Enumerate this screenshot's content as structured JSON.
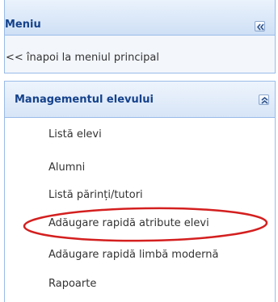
{
  "menu": {
    "title": "Meniu",
    "back_link": "<< înapoi la meniul principal"
  },
  "section": {
    "title": "Managementul elevului",
    "items": [
      {
        "label": "Listă elevi"
      },
      {
        "label": "Alumni"
      },
      {
        "label": "Listă părinți/tutori"
      },
      {
        "label": "Adăugare rapidă atribute elevi"
      },
      {
        "label": "Adăugare rapidă limbă modernă"
      },
      {
        "label": "Rapoarte"
      }
    ]
  },
  "annotation": {
    "highlighted_item": "Adăugare rapidă atribute elevi",
    "color": "#d41f1f"
  },
  "colors": {
    "header_text": "#15428b",
    "border": "#99bbe8"
  },
  "icons": {
    "menu_collapse": "double-chevron-left-icon",
    "section_collapse": "double-chevron-up-icon"
  }
}
